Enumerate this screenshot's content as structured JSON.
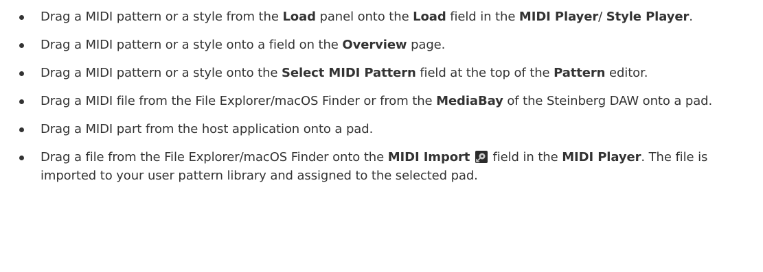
{
  "bullets": [
    {
      "t1": "Drag a MIDI pattern or a style from the ",
      "b1": "Load",
      "t2": " panel onto the ",
      "b2": "Load",
      "t3": " field in the ",
      "b3": "MIDI Player",
      "t4": "/ ",
      "b4": "Style Player",
      "t5": "."
    },
    {
      "t1": "Drag a MIDI pattern or a style onto a field on the ",
      "b1": "Overview",
      "t2": " page."
    },
    {
      "t1": "Drag a MIDI pattern or a style onto the ",
      "b1": "Select MIDI Pattern",
      "t2": " field at the top of the ",
      "b2": "Pattern",
      "t3": " editor."
    },
    {
      "t1": "Drag a MIDI file from the File Explorer/macOS Finder or from the ",
      "b1": "MediaBay",
      "t2": " of the Steinberg DAW onto a pad."
    },
    {
      "t1": "Drag a MIDI part from the host application onto a pad."
    },
    {
      "t1": "Drag a file from the File Explorer/macOS Finder onto the ",
      "b1": "MIDI Import",
      "icon": "midi-import-icon",
      "t2": " field in the ",
      "b2": "MIDI Player",
      "t3": ". The file is imported to your user pattern library and assigned to the selected pad."
    }
  ],
  "colors": {
    "text": "#333333",
    "bullet": "#333333",
    "icon_bg": "#2b2b2b",
    "icon_accent": "#c9c9c9"
  }
}
